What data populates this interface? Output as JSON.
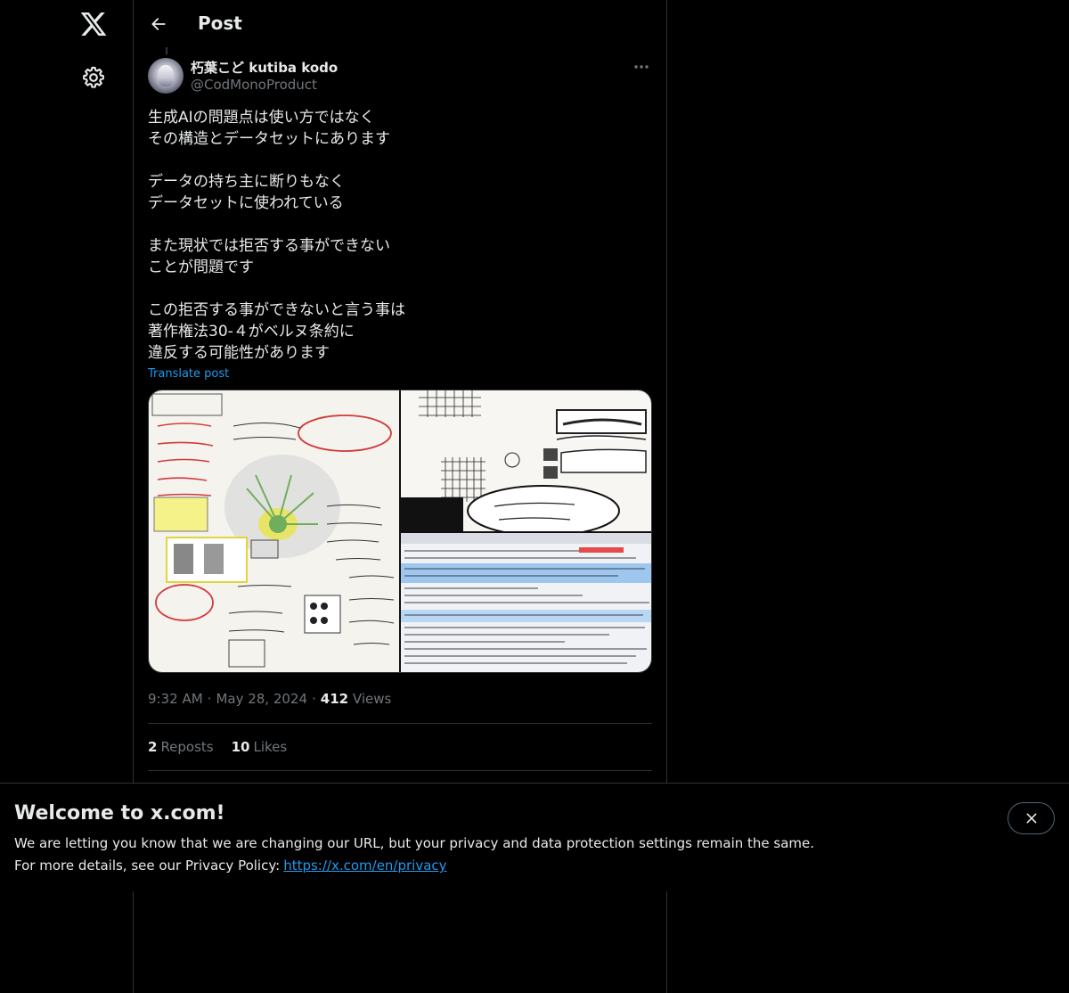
{
  "header": {
    "title": "Post"
  },
  "author": {
    "display_name": "朽葉こど kutiba kodo",
    "handle": "@CodMonoProduct"
  },
  "post": {
    "text": "生成AIの問題点は使い方ではなく\nその構造とデータセットにあります\n\nデータの持ち主に断りもなく\nデータセットに使われている\n\nまた現状では拒否する事ができない\nことが問題です\n\nこの拒否する事ができないと言う事は\n著作権法30-４がベルヌ条約に\n違反する可能性があります",
    "translate_label": "Translate post",
    "time": "9:32 AM",
    "date": "May 28, 2024",
    "views_count": "412",
    "views_label": "Views",
    "reposts_count": "2",
    "reposts_label": "Reposts",
    "likes_count": "10",
    "likes_label": "Likes"
  },
  "banner": {
    "title": "Welcome to x.com!",
    "line1": "We are letting you know that we are changing our URL, but your privacy and data protection settings remain the same.",
    "line2_prefix": "For more details, see our Privacy Policy:",
    "link": "https://x.com/en/privacy"
  },
  "icons": {
    "logo": "x-logo-icon",
    "settings": "gear-icon",
    "back": "arrow-left-icon",
    "more": "more-dots-icon",
    "close": "close-icon"
  },
  "colors": {
    "background": "#000000",
    "text": "#e7e9ea",
    "muted": "#71767b",
    "accent": "#1d9bf0",
    "border": "#2f3336"
  }
}
